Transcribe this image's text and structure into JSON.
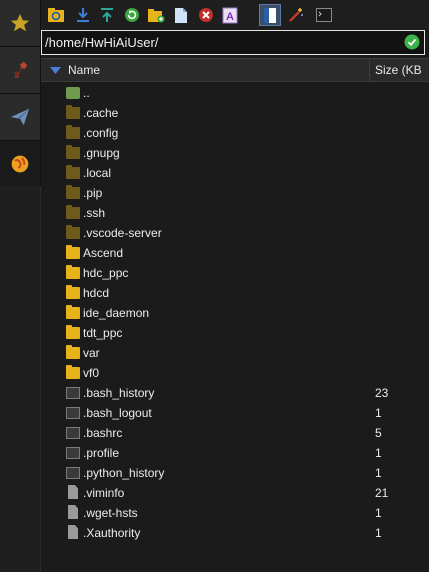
{
  "path": "/home/HwHiAiUser/",
  "columns": {
    "name": "Name",
    "size": "Size (KB"
  },
  "toolbar_icons": [
    "refresh-folder-icon",
    "download-icon",
    "upload-icon",
    "refresh-icon",
    "new-folder-icon",
    "new-file-icon",
    "delete-icon",
    "rename-icon",
    "editor-icon",
    "magic-wand-icon",
    "terminal-icon"
  ],
  "side_tabs": [
    "star-icon",
    "tools-icon",
    "send-icon",
    "globe-icon"
  ],
  "colors": {
    "accent": "#4c7fd4",
    "folder": "#e8b31a",
    "hidden_folder": "#6e5a1c",
    "ok": "#3db34a"
  },
  "rows": [
    {
      "name": "..",
      "size": "",
      "kind": "up"
    },
    {
      "name": ".cache",
      "size": "",
      "kind": "hid"
    },
    {
      "name": ".config",
      "size": "",
      "kind": "hid"
    },
    {
      "name": ".gnupg",
      "size": "",
      "kind": "hid"
    },
    {
      "name": ".local",
      "size": "",
      "kind": "hid"
    },
    {
      "name": ".pip",
      "size": "",
      "kind": "hid"
    },
    {
      "name": ".ssh",
      "size": "",
      "kind": "hid"
    },
    {
      "name": ".vscode-server",
      "size": "",
      "kind": "hid"
    },
    {
      "name": "Ascend",
      "size": "",
      "kind": "dir"
    },
    {
      "name": "hdc_ppc",
      "size": "",
      "kind": "dir"
    },
    {
      "name": "hdcd",
      "size": "",
      "kind": "dir"
    },
    {
      "name": "ide_daemon",
      "size": "",
      "kind": "dir"
    },
    {
      "name": "tdt_ppc",
      "size": "",
      "kind": "dir"
    },
    {
      "name": "var",
      "size": "",
      "kind": "dir"
    },
    {
      "name": "vf0",
      "size": "",
      "kind": "dir"
    },
    {
      "name": ".bash_history",
      "size": "23",
      "kind": "term"
    },
    {
      "name": ".bash_logout",
      "size": "1",
      "kind": "term"
    },
    {
      "name": ".bashrc",
      "size": "5",
      "kind": "term"
    },
    {
      "name": ".profile",
      "size": "1",
      "kind": "term"
    },
    {
      "name": ".python_history",
      "size": "1",
      "kind": "term"
    },
    {
      "name": ".viminfo",
      "size": "21",
      "kind": "file"
    },
    {
      "name": ".wget-hsts",
      "size": "1",
      "kind": "file"
    },
    {
      "name": ".Xauthority",
      "size": "1",
      "kind": "file"
    }
  ]
}
